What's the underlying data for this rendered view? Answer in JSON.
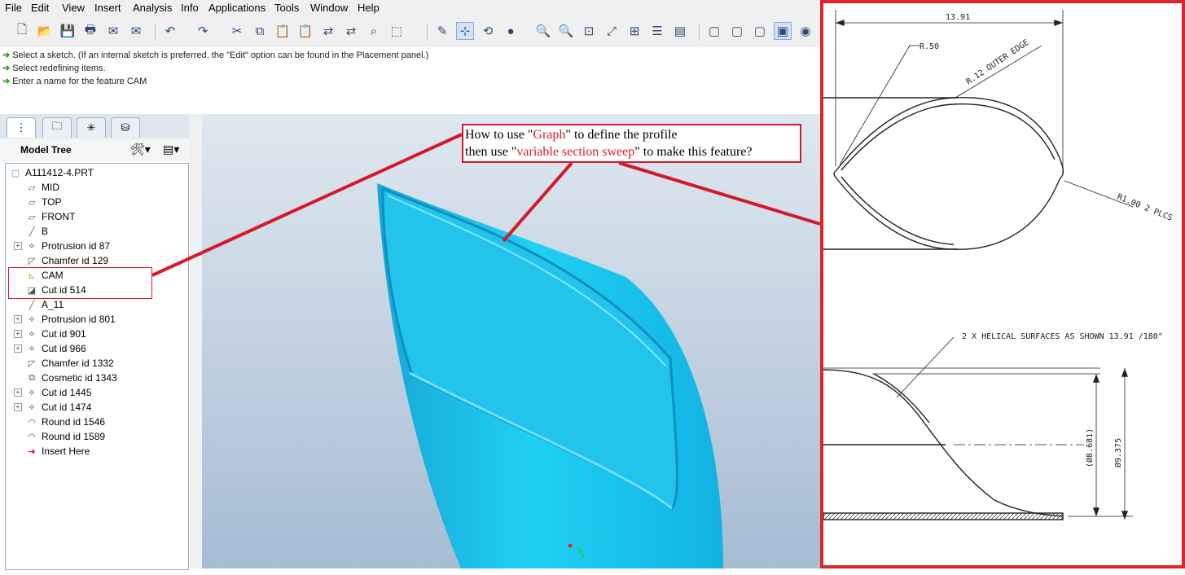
{
  "menu": [
    "File",
    "Edit",
    "View",
    "Insert",
    "Analysis",
    "Info",
    "Applications",
    "Tools",
    "Window",
    "Help"
  ],
  "messages": [
    "Select a sketch. (If an internal sketch is preferred, the \"Edit\" option can be found in the Placement panel.)",
    "Select redefining items.",
    "Enter a name for the feature   CAM"
  ],
  "model_tree": {
    "title": "Model Tree",
    "root": "A111412-4.PRT",
    "items": [
      {
        "label": "MID",
        "icon": "datum-plane-icon",
        "expand": false
      },
      {
        "label": "TOP",
        "icon": "datum-plane-icon",
        "expand": false
      },
      {
        "label": "FRONT",
        "icon": "datum-plane-icon",
        "expand": false
      },
      {
        "label": "B",
        "icon": "datum-axis-icon",
        "expand": false
      },
      {
        "label": "Protrusion id 87",
        "icon": "protrusion-icon",
        "expand": true
      },
      {
        "label": "Chamfer id 129",
        "icon": "chamfer-icon",
        "expand": false
      },
      {
        "label": "CAM",
        "icon": "graph-icon",
        "expand": false
      },
      {
        "label": "Cut id 514",
        "icon": "variable-sweep-cut-icon",
        "expand": false
      },
      {
        "label": "A_11",
        "icon": "datum-axis-icon",
        "expand": false
      },
      {
        "label": "Protrusion id 801",
        "icon": "protrusion-icon",
        "expand": true
      },
      {
        "label": "Cut id 901",
        "icon": "cut-icon",
        "expand": true
      },
      {
        "label": "Cut id 966",
        "icon": "cut-icon",
        "expand": true
      },
      {
        "label": "Chamfer id 1332",
        "icon": "chamfer-icon",
        "expand": false
      },
      {
        "label": "Cosmetic id 1343",
        "icon": "cosmetic-thread-icon",
        "expand": false
      },
      {
        "label": "Cut id 1445",
        "icon": "cut-icon",
        "expand": true
      },
      {
        "label": "Cut id 1474",
        "icon": "cut-icon",
        "expand": true
      },
      {
        "label": "Round id 1546",
        "icon": "round-icon",
        "expand": false
      },
      {
        "label": "Round id 1589",
        "icon": "round-icon",
        "expand": false
      },
      {
        "label": "Insert Here",
        "icon": "insert-arrow-icon",
        "expand": false
      }
    ]
  },
  "callout": {
    "line1_pre": "How to use \"",
    "line1_red": "Graph",
    "line1_post": "\" to define the profile",
    "line2_pre": "then use \"",
    "line2_red": "variable section sweep",
    "line2_post": "\" to make this feature?"
  },
  "drawing": {
    "dim_top": "13.91",
    "r50": "R.50",
    "r12": "R.12 OUTER EDGE",
    "r100": "R1.00 2 PLCS",
    "helical": "2 X HELICAL SURFACES AS SHOWN 13.91 /180°",
    "dia1": "(Ø8.681)",
    "dia2": "Ø9.375"
  },
  "colors": {
    "part": "#1ec8ee",
    "accent_red": "#d41a2a",
    "border_red": "#e0232b"
  }
}
